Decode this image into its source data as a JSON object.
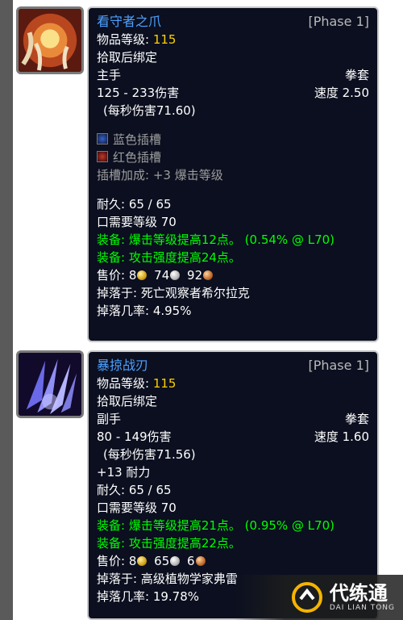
{
  "items": [
    {
      "name": "看守者之爪",
      "phase": "[Phase 1]",
      "ilvl_label": "物品等级:",
      "ilvl_value": "115",
      "bind": "拾取后绑定",
      "slot": "主手",
      "type": "拳套",
      "damage": "125 - 233伤害",
      "speed": "速度 2.50",
      "dps": "(每秒伤害71.60)",
      "sockets": [
        {
          "color": "blue",
          "label": "蓝色插槽"
        },
        {
          "color": "red",
          "label": "红色插槽"
        }
      ],
      "socket_bonus": "插槽加成: +3 爆击等级",
      "durability": "耐久: 65 / 65",
      "req_level": "口需要等级 70",
      "equip1": "装备: 爆击等级提高12点。 (0.54% @ L70)",
      "equip2": "装备:  攻击强度提高24点。",
      "sell_label": "售价:",
      "sell_gold": "8",
      "sell_silver": "74",
      "sell_copper": "92",
      "drop": "掉落于: 死亡观察者希尔拉克",
      "drop_rate": "掉落几率: 4.95%",
      "icon": "claw-weapon-icon"
    },
    {
      "name": "暴掠战刃",
      "phase": "[Phase 1]",
      "ilvl_label": "物品等级:",
      "ilvl_value": "115",
      "bind": "拾取后绑定",
      "slot": "副手",
      "type": "拳套",
      "damage": "80 - 149伤害",
      "speed": "速度 1.60",
      "dps": "(每秒伤害71.56)",
      "stamina": "+13 耐力",
      "durability": "耐久: 65 / 65",
      "req_level": "口需要等级 70",
      "equip1": "装备: 爆击等级提高21点。 (0.95% @ L70)",
      "equip2": "装备:  攻击强度提高22点。",
      "sell_label": "售价:",
      "sell_gold": "8",
      "sell_silver": "65",
      "sell_copper": "6",
      "drop": "掉落于: 高级植物学家弗雷",
      "drop_rate": "掉落几率: 19.78%",
      "icon": "blade-weapon-icon"
    }
  ],
  "watermark": {
    "cn": "代练通",
    "en": "DAI LIAN TONG"
  },
  "colors": {
    "name": "#4ea1ff",
    "ilvl": "#ffd100",
    "equip": "#00ff00",
    "bg": "#0b0f1f"
  }
}
